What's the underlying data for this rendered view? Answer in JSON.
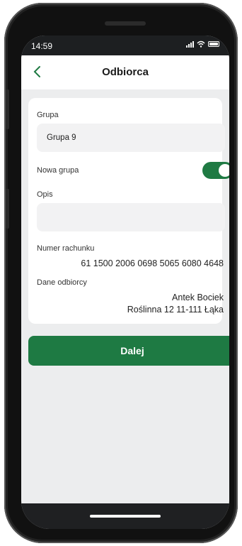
{
  "status": {
    "time": "14:59"
  },
  "header": {
    "title": "Odbiorca"
  },
  "form": {
    "group_label": "Grupa",
    "group_value": "Grupa 9",
    "new_group_label": "Nowa grupa",
    "new_group_enabled": true,
    "description_label": "Opis",
    "description_value": "",
    "account_label": "Numer rachunku",
    "account_value": "61 1500 2006 0698 5065 6080 4648",
    "recipient_label": "Dane odbiorcy",
    "recipient_name": "Antek Bociek",
    "recipient_address": "Roślinna 12 11-111 Łąka"
  },
  "actions": {
    "next_label": "Dalej"
  },
  "colors": {
    "accent": "#1f7a43"
  }
}
